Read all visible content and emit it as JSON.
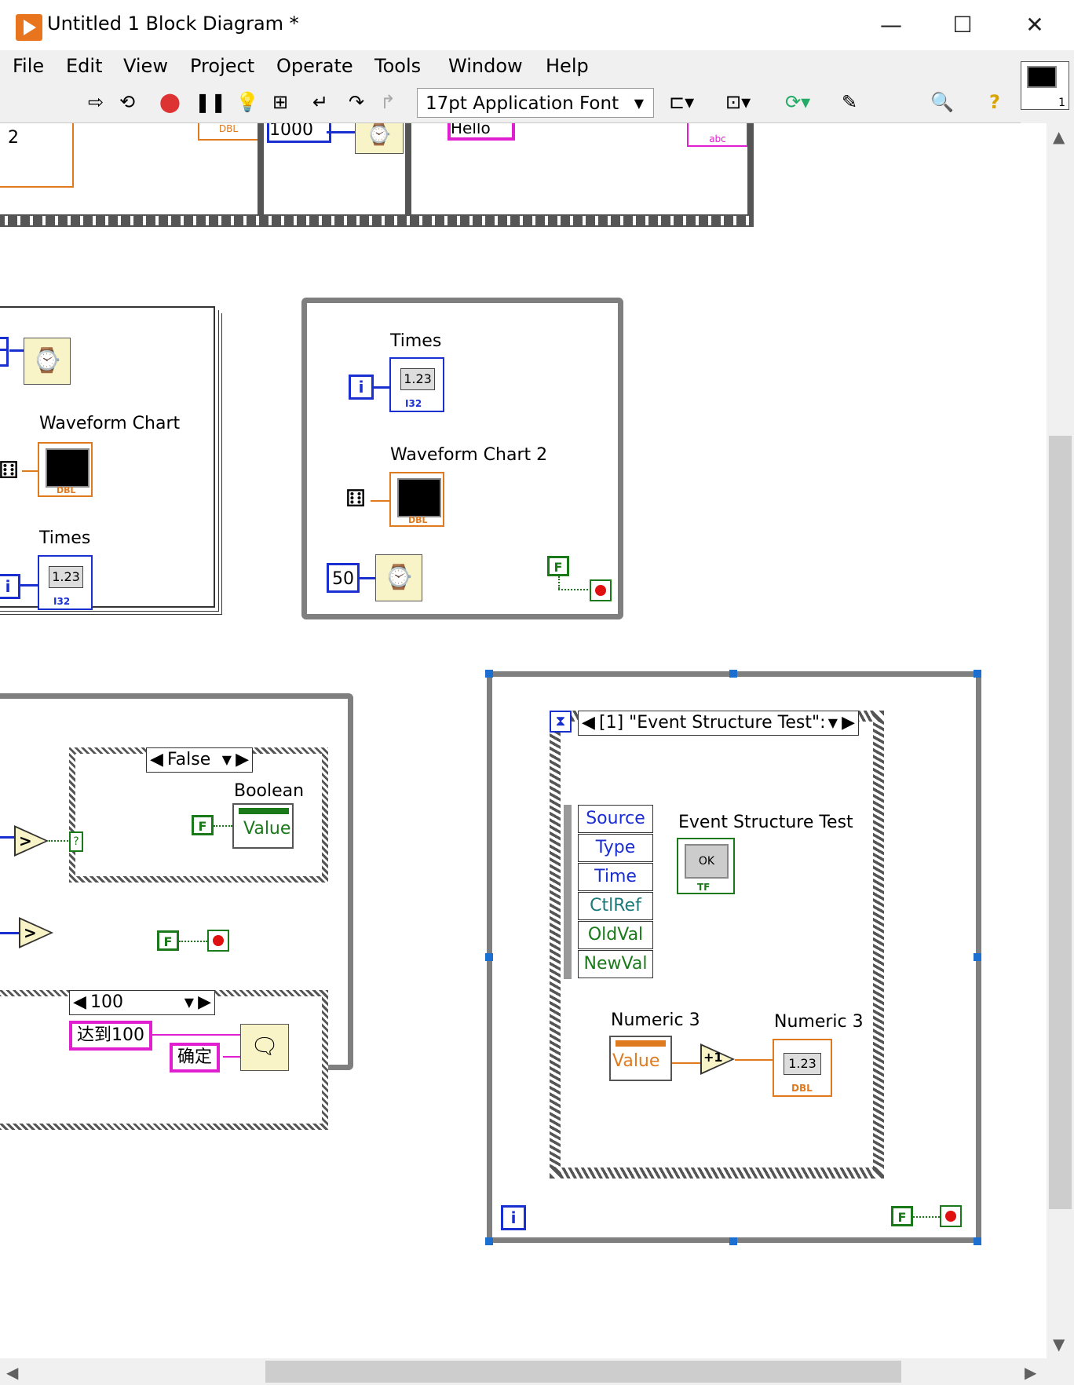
{
  "window": {
    "title": "Untitled 1 Block Diagram *",
    "minimize": "—",
    "maximize": "☐",
    "close": "✕"
  },
  "menu": [
    "File",
    "Edit",
    "View",
    "Project",
    "Operate",
    "Tools",
    "Window",
    "Help"
  ],
  "toolbar": {
    "font": "17pt Application Font",
    "vi_icon_number": "1"
  },
  "diagram": {
    "top_frag": {
      "text_2": "2",
      "const_1000": "1000",
      "string_hello": "Hello"
    },
    "loop_left": {
      "label_chart": "Waveform Chart",
      "label_times": "Times",
      "iter": "i"
    },
    "loop_mid": {
      "label_times": "Times",
      "label_chart": "Waveform Chart 2",
      "iter": "i",
      "const_50": "50",
      "bool": "F"
    },
    "case_false": {
      "selector": "False",
      "label_boolean": "Boolean",
      "value": "Value",
      "bool": "F",
      "q": "?"
    },
    "compare": ">",
    "bool_stop": "F",
    "case_100": {
      "selector": "100",
      "msg": "达到100",
      "ok": "确定"
    },
    "event": {
      "selector": "[1] \"Event Structure Test\":",
      "nodes": [
        "Source",
        "Type",
        "Time",
        "CtlRef",
        "OldVal",
        "NewVal"
      ],
      "label_button": "Event Structure Test",
      "ok": "OK",
      "label_num_in": "Numeric 3",
      "label_num_out": "Numeric 3",
      "value": "Value",
      "inc": "+1",
      "iter": "i",
      "bool": "F"
    },
    "type_i32": "I32",
    "type_dbl": "DBL",
    "type_tf": "TF",
    "type_abc": "abc",
    "num_display": "1.23"
  },
  "colors": {
    "int_wire": "#1a2fd0",
    "dbl_wire": "#e07a1f",
    "bool_wire": "#1a7a1a",
    "string_wire": "#e020d0"
  }
}
